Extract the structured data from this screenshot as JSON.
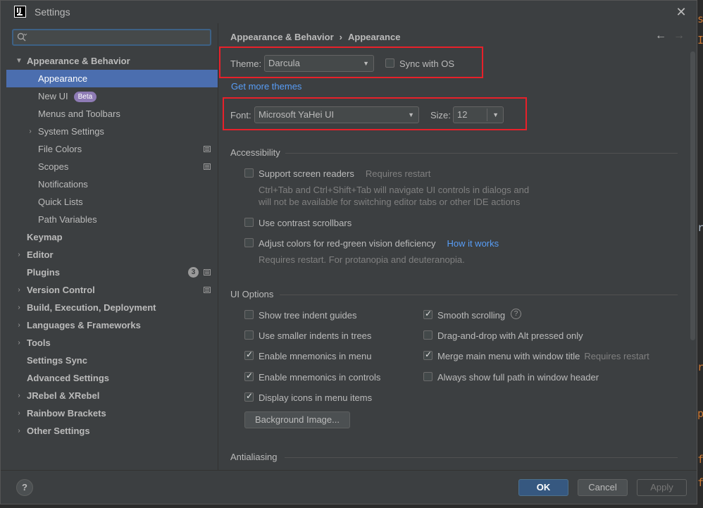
{
  "window": {
    "title": "Settings"
  },
  "search": {
    "placeholder": "",
    "value": ""
  },
  "sidebar": {
    "items": [
      {
        "label": "Appearance & Behavior"
      },
      {
        "label": "Appearance"
      },
      {
        "label": "New UI",
        "badge": "Beta"
      },
      {
        "label": "Menus and Toolbars"
      },
      {
        "label": "System Settings"
      },
      {
        "label": "File Colors"
      },
      {
        "label": "Scopes"
      },
      {
        "label": "Notifications"
      },
      {
        "label": "Quick Lists"
      },
      {
        "label": "Path Variables"
      },
      {
        "label": "Keymap"
      },
      {
        "label": "Editor"
      },
      {
        "label": "Plugins",
        "badge": "3"
      },
      {
        "label": "Version Control"
      },
      {
        "label": "Build, Execution, Deployment"
      },
      {
        "label": "Languages & Frameworks"
      },
      {
        "label": "Tools"
      },
      {
        "label": "Settings Sync"
      },
      {
        "label": "Advanced Settings"
      },
      {
        "label": "JRebel & XRebel"
      },
      {
        "label": "Rainbow Brackets"
      },
      {
        "label": "Other Settings"
      }
    ]
  },
  "breadcrumb": {
    "parent": "Appearance & Behavior",
    "separator": "›",
    "current": "Appearance"
  },
  "theme": {
    "label": "Theme:",
    "value": "Darcula",
    "sync_label": "Sync with OS",
    "get_more": "Get more themes"
  },
  "font": {
    "label": "Font:",
    "value": "Microsoft YaHei UI",
    "size_label": "Size:",
    "size_value": "12"
  },
  "accessibility": {
    "title": "Accessibility",
    "screen_readers": "Support screen readers",
    "requires_restart": "Requires restart",
    "screen_readers_note_1": "Ctrl+Tab and Ctrl+Shift+Tab will navigate UI controls in dialogs and",
    "screen_readers_note_2": "will not be available for switching editor tabs or other IDE actions",
    "contrast_scrollbars": "Use contrast scrollbars",
    "adjust_colors": "Adjust colors for red-green vision deficiency",
    "how_it_works": "How it works",
    "adjust_note": "Requires restart. For protanopia and deuteranopia."
  },
  "ui_options": {
    "title": "UI Options",
    "tree_indent": "Show tree indent guides",
    "smaller_indents": "Use smaller indents in trees",
    "mnemonics_menu": "Enable mnemonics in menu",
    "mnemonics_controls": "Enable mnemonics in controls",
    "display_icons": "Display icons in menu items",
    "smooth_scrolling": "Smooth scrolling",
    "drag_drop": "Drag-and-drop with Alt pressed only",
    "merge_menu": "Merge main menu with window title",
    "merge_restart": "Requires restart",
    "full_path": "Always show full path in window header",
    "bg_image": "Background Image..."
  },
  "antialiasing": {
    "title": "Antialiasing"
  },
  "footer": {
    "help": "?",
    "ok": "OK",
    "cancel": "Cancel",
    "apply": "Apply"
  },
  "colors": {
    "accent": "#4b6eaf",
    "highlight": "#e8202a",
    "link": "#589df6"
  }
}
